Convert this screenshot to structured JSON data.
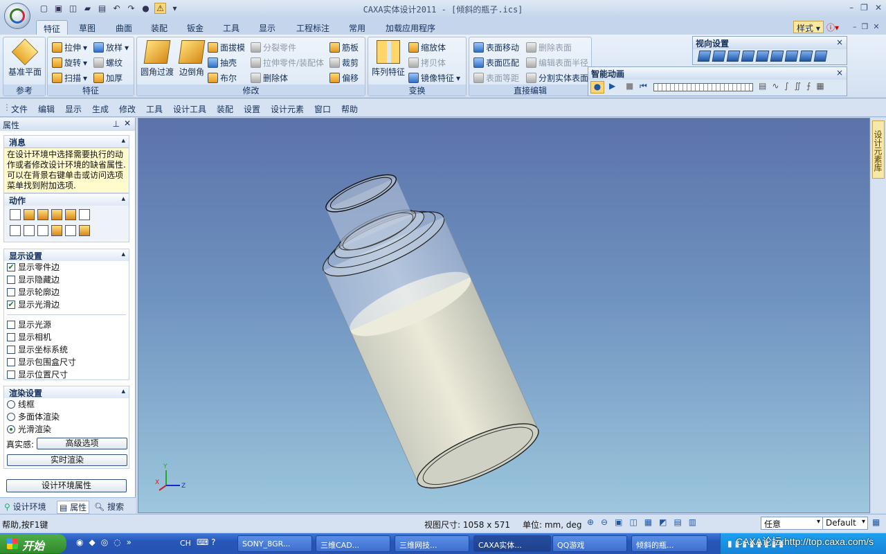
{
  "window": {
    "title": "CAXA实体设计2011 - [倾斜的瓶子.ics]"
  },
  "tabs": [
    "特征",
    "草图",
    "曲面",
    "装配",
    "钣金",
    "工具",
    "显示",
    "工程标注",
    "常用",
    "加载应用程序"
  ],
  "style_dropdown": "样式",
  "ribbon": {
    "ref_group": {
      "label": "参考",
      "btn": "基准平面"
    },
    "feature_group": {
      "label": "特征",
      "items": [
        "拉伸",
        "放样",
        "旋转",
        "螺纹",
        "扫描",
        "加厚"
      ]
    },
    "modify_group": {
      "label": "修改",
      "big": [
        "圆角过渡",
        "边倒角"
      ],
      "items": [
        "面拔模",
        "分裂零件",
        "筋板",
        "抽壳",
        "拉伸零件/装配体",
        "裁剪",
        "布尔",
        "删除体",
        "偏移"
      ]
    },
    "transform_group": {
      "label": "变换",
      "big": "阵列特征",
      "items": [
        "缩放体",
        "拷贝体",
        "镜像特征"
      ]
    },
    "direct_group": {
      "label": "直接编辑",
      "items": [
        "表面移动",
        "删除表面",
        "表面匹配",
        "编辑表面半径",
        "表面等距",
        "分割实体表面"
      ]
    }
  },
  "view_panel": {
    "title": "视向设置",
    "close": "×"
  },
  "anim_panel": {
    "title": "智能动画",
    "close": "×"
  },
  "menu": [
    "文件",
    "编辑",
    "显示",
    "生成",
    "修改",
    "工具",
    "设计工具",
    "装配",
    "设置",
    "设计元素",
    "窗口",
    "帮助"
  ],
  "left_panel": {
    "title": "属性",
    "message": {
      "title": "消息",
      "text": "在设计环境中选择需要执行的动作或者修改设计环境的缺省属性. 可以在背景右键单击或访问选项菜单找到附加选项."
    },
    "actions": {
      "title": "动作"
    },
    "display": {
      "title": "显示设置",
      "items": [
        {
          "label": "显示零件边",
          "checked": true
        },
        {
          "label": "显示隐藏边",
          "checked": false
        },
        {
          "label": "显示轮廓边",
          "checked": false
        },
        {
          "label": "显示光滑边",
          "checked": true
        },
        {
          "label": "显示光源",
          "checked": false
        },
        {
          "label": "显示相机",
          "checked": false
        },
        {
          "label": "显示坐标系统",
          "checked": false
        },
        {
          "label": "显示包围盒尺寸",
          "checked": false
        },
        {
          "label": "显示位置尺寸",
          "checked": false
        }
      ]
    },
    "render": {
      "title": "渲染设置",
      "options": [
        "线框",
        "多面体渲染",
        "光滑渲染"
      ],
      "selected": "光滑渲染",
      "realism_label": "真实感:",
      "advanced_btn": "高级选项",
      "realtime_btn": "实时渲染"
    },
    "env_btn": "设计环境属性",
    "bottom_tabs": [
      "设计环境",
      "属性",
      "搜索"
    ]
  },
  "right_strip": "设计元素库",
  "status": {
    "help": "帮助,按F1键",
    "view_size": "视图尺寸: 1058 x 571",
    "units": "单位: mm, deg",
    "combo1": "任意",
    "combo2": "Default"
  },
  "taskbar": {
    "start": "开始",
    "lang": "CH",
    "buttons": [
      "SONY_8GR...",
      "三维CAD...",
      "三维网技...",
      "CAXA实体...",
      "QQ游戏",
      "倾斜的瓶..."
    ],
    "active": "CAXA实体..."
  },
  "watermark": "CAXA论坛:http://top.caxa.com/s",
  "colors": {
    "accent": "#15305a",
    "viewport_top": "#5b72aa",
    "viewport_bottom": "#9cc7dd"
  }
}
